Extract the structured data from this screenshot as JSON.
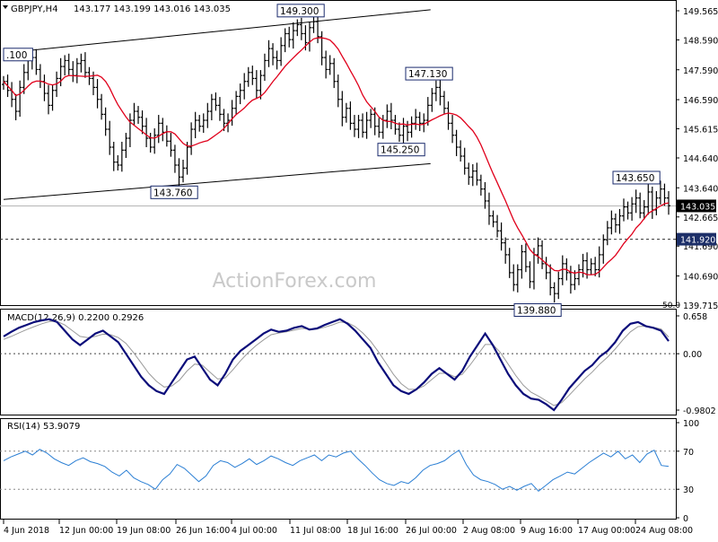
{
  "header": {
    "symbol": "GBPJPY,H4",
    "ohlc": "143.177 143.199 143.016 143.035"
  },
  "watermark": "ActionForex.com",
  "colors": {
    "candles": "#000000",
    "ma": "#e0001b",
    "channel": "#000000",
    "macd_line": "#0b0d7a",
    "macd_signal": "#9a9a9a",
    "rsi_line": "#2b7fd4",
    "last_price_bg": "#000000",
    "level_tag_bg": "#1c2f68",
    "annotation_border": "#1a2a6c"
  },
  "chart_data": [
    {
      "type": "candlestick",
      "title": "GBPJPY,H4",
      "ylim": [
        139.715,
        149.565
      ],
      "y_ticks": [
        "149.565",
        "148.590",
        "147.590",
        "146.590",
        "145.615",
        "144.640",
        "143.640",
        "142.665",
        "141.690",
        "140.690",
        "139.715"
      ],
      "x_ticks": [
        "4 Jun 2018",
        "12 Jun 00:00",
        "19 Jun 08:00",
        "26 Jun 16:00",
        "4 Jul 00:00",
        "11 Jul 08:00",
        "18 Jul 16:00",
        "26 Jul 00:00",
        "2 Aug 08:00",
        "9 Aug 16:00",
        "17 Aug 00:00",
        "24 Aug 08:00"
      ],
      "last_price": "143.035",
      "support_level": "141.920",
      "moving_average_label": "50.0",
      "annotations": [
        {
          "label": ".100",
          "value": 148.1
        },
        {
          "label": "149.300",
          "value": 149.3
        },
        {
          "label": "143.760",
          "value": 143.76
        },
        {
          "label": "147.130",
          "value": 147.13
        },
        {
          "label": "145.250",
          "value": 145.25
        },
        {
          "label": "139.880",
          "value": 139.88
        },
        {
          "label": "143.650",
          "value": 143.65
        }
      ],
      "channel": {
        "upper": [
          [
            0,
            148.15
          ],
          [
            0.6,
            149.6
          ]
        ],
        "lower": [
          [
            0,
            143.25
          ],
          [
            0.6,
            144.45
          ]
        ]
      },
      "closes": [
        147.2,
        146.9,
        146.6,
        146.2,
        147.0,
        147.5,
        147.9,
        148.0,
        147.6,
        147.2,
        146.8,
        146.4,
        146.9,
        147.3,
        147.7,
        147.9,
        147.6,
        147.4,
        147.8,
        147.9,
        147.5,
        147.3,
        147.0,
        146.6,
        146.1,
        145.6,
        145.0,
        144.5,
        144.4,
        144.9,
        145.3,
        145.9,
        146.2,
        146.0,
        145.7,
        145.3,
        145.0,
        145.4,
        145.8,
        145.5,
        145.2,
        144.9,
        144.4,
        144.0,
        144.3,
        145.0,
        145.6,
        145.9,
        145.7,
        145.9,
        146.2,
        146.6,
        146.4,
        146.1,
        145.8,
        145.9,
        146.3,
        146.7,
        146.9,
        147.2,
        147.5,
        147.3,
        146.9,
        147.4,
        147.9,
        148.3,
        148.0,
        147.9,
        148.4,
        148.8,
        148.6,
        148.9,
        149.1,
        148.8,
        148.5,
        149.0,
        149.2,
        148.7,
        148.0,
        147.6,
        147.8,
        147.2,
        146.6,
        146.0,
        146.3,
        145.8,
        145.6,
        145.9,
        145.5,
        145.9,
        146.1,
        145.7,
        145.5,
        145.9,
        146.2,
        145.9,
        145.6,
        145.4,
        145.7,
        145.5,
        145.8,
        146.0,
        145.8,
        145.9,
        146.4,
        146.8,
        147.0,
        146.7,
        146.3,
        145.8,
        145.4,
        145.0,
        144.7,
        144.3,
        144.0,
        144.2,
        143.9,
        143.6,
        143.2,
        142.7,
        142.5,
        142.2,
        141.8,
        141.4,
        140.8,
        140.4,
        140.9,
        141.5,
        141.0,
        140.5,
        141.4,
        141.7,
        141.1,
        140.8,
        140.3,
        140.1,
        140.6,
        141.1,
        140.8,
        140.4,
        140.6,
        140.9,
        141.2,
        140.9,
        141.1,
        140.9,
        141.4,
        141.9,
        142.3,
        142.6,
        142.4,
        142.7,
        143.0,
        142.8,
        143.1,
        143.3,
        142.8,
        143.0,
        143.5,
        142.9,
        143.3,
        143.6,
        143.3,
        143.04
      ]
    },
    {
      "type": "line",
      "title": "MACD(12,26,9) 0.2200 0.2926",
      "ylim": [
        -0.9802,
        0.658
      ],
      "y_ticks": [
        "0.658",
        "0.00",
        "-0.9802"
      ],
      "series": [
        {
          "name": "MACD",
          "values": [
            0.3,
            0.38,
            0.45,
            0.5,
            0.55,
            0.58,
            0.6,
            0.55,
            0.4,
            0.25,
            0.15,
            0.25,
            0.35,
            0.4,
            0.3,
            0.2,
            0.0,
            -0.2,
            -0.4,
            -0.55,
            -0.65,
            -0.7,
            -0.5,
            -0.3,
            -0.1,
            -0.05,
            -0.25,
            -0.45,
            -0.55,
            -0.35,
            -0.1,
            0.05,
            0.15,
            0.25,
            0.35,
            0.42,
            0.38,
            0.4,
            0.45,
            0.48,
            0.42,
            0.44,
            0.5,
            0.55,
            0.6,
            0.52,
            0.4,
            0.25,
            0.1,
            -0.15,
            -0.35,
            -0.55,
            -0.65,
            -0.7,
            -0.62,
            -0.5,
            -0.35,
            -0.25,
            -0.35,
            -0.45,
            -0.3,
            -0.05,
            0.15,
            0.35,
            0.15,
            -0.1,
            -0.35,
            -0.55,
            -0.7,
            -0.78,
            -0.8,
            -0.88,
            -0.98,
            -0.8,
            -0.6,
            -0.45,
            -0.3,
            -0.2,
            -0.05,
            0.05,
            0.2,
            0.4,
            0.52,
            0.55,
            0.48,
            0.45,
            0.4,
            0.22
          ]
        },
        {
          "name": "Signal",
          "values": [
            0.25,
            0.3,
            0.36,
            0.42,
            0.47,
            0.52,
            0.56,
            0.56,
            0.5,
            0.4,
            0.3,
            0.28,
            0.3,
            0.34,
            0.33,
            0.28,
            0.18,
            0.02,
            -0.16,
            -0.34,
            -0.48,
            -0.58,
            -0.56,
            -0.46,
            -0.3,
            -0.18,
            -0.2,
            -0.32,
            -0.44,
            -0.42,
            -0.28,
            -0.12,
            0.02,
            0.14,
            0.24,
            0.33,
            0.36,
            0.38,
            0.41,
            0.44,
            0.43,
            0.43,
            0.46,
            0.5,
            0.55,
            0.54,
            0.47,
            0.36,
            0.22,
            0.04,
            -0.16,
            -0.36,
            -0.52,
            -0.62,
            -0.62,
            -0.56,
            -0.45,
            -0.34,
            -0.34,
            -0.4,
            -0.36,
            -0.2,
            -0.02,
            0.16,
            0.16,
            0.02,
            -0.18,
            -0.38,
            -0.55,
            -0.67,
            -0.74,
            -0.82,
            -0.9,
            -0.85,
            -0.72,
            -0.58,
            -0.44,
            -0.32,
            -0.18,
            -0.06,
            0.08,
            0.24,
            0.38,
            0.47,
            0.48,
            0.46,
            0.43,
            0.29
          ]
        }
      ]
    },
    {
      "type": "line",
      "title": "RSI(14) 53.9079",
      "ylim": [
        0,
        100
      ],
      "y_ticks": [
        "100",
        "70",
        "30",
        "0"
      ],
      "levels": [
        70,
        30
      ],
      "series": [
        {
          "name": "RSI",
          "values": [
            60,
            64,
            67,
            70,
            66,
            72,
            68,
            62,
            58,
            55,
            60,
            63,
            59,
            57,
            54,
            48,
            44,
            50,
            42,
            38,
            35,
            30,
            40,
            46,
            56,
            52,
            45,
            38,
            44,
            55,
            60,
            58,
            53,
            57,
            62,
            56,
            60,
            65,
            62,
            58,
            55,
            60,
            63,
            66,
            60,
            66,
            64,
            68,
            70,
            62,
            55,
            47,
            40,
            36,
            34,
            38,
            36,
            42,
            50,
            55,
            57,
            60,
            66,
            71,
            56,
            45,
            40,
            38,
            35,
            30,
            33,
            29,
            33,
            36,
            28,
            34,
            40,
            44,
            48,
            46,
            52,
            58,
            63,
            68,
            64,
            70,
            62,
            66,
            58,
            67,
            71,
            55,
            54
          ]
        }
      ]
    }
  ]
}
